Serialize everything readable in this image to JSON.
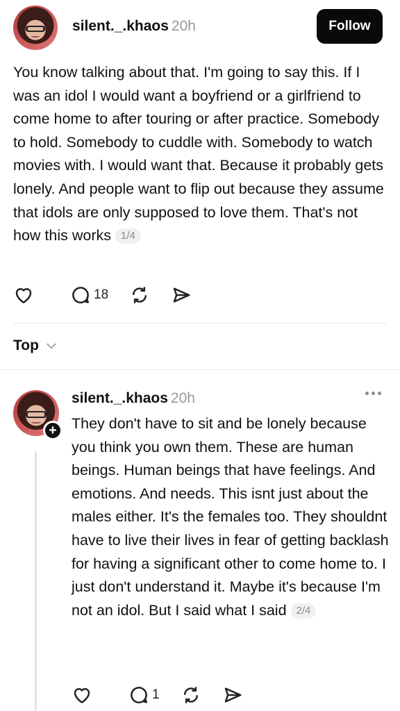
{
  "post1": {
    "username": "silent._.khaos",
    "time": "20h",
    "follow_label": "Follow",
    "text": "You know talking about that. I'm going to say this. If I was an idol I would want a boyfriend or a girlfriend to come home to after touring or after practice. Somebody to hold. Somebody to cuddle with. Somebody to watch movies with. I would want that. Because it probably gets lonely. And people want to flip out because they assume that idols are only supposed to love them. That's not how this works",
    "page_indicator": "1/4",
    "reply_count": "18",
    "icons": [
      "heart-icon",
      "comment-icon",
      "repost-icon",
      "share-icon"
    ]
  },
  "sort": {
    "label": "Top",
    "icon": "chevron-down-icon"
  },
  "post2": {
    "username": "silent._.khaos",
    "time": "20h",
    "text": "They don't have to sit and be lonely because you think you own them. These are human beings. Human beings that have feelings. And emotions. And needs. This isnt just about the males either. It's the females too. They shouldnt have to live their lives in fear of getting backlash for having a significant other to come home to. I just don't understand it. Maybe it's because I'm not an idol. But I said what I said",
    "page_indicator": "2/4",
    "reply_count": "1",
    "badge": "+",
    "icons": [
      "heart-icon",
      "comment-icon",
      "repost-icon",
      "share-icon",
      "more-icon"
    ]
  },
  "colors": {
    "text": "#111111",
    "muted": "#9a9a9a",
    "button_bg": "#0a0a0a",
    "divider": "#e8e8e8"
  }
}
